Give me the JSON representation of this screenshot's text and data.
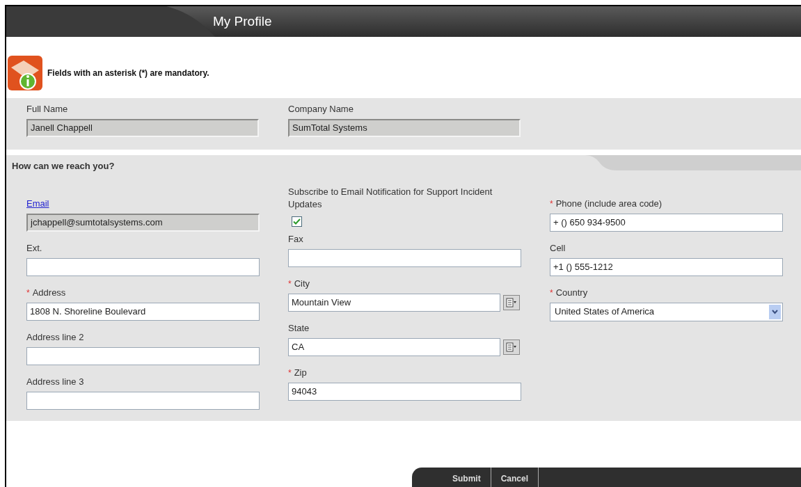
{
  "header": {
    "title": "My Profile"
  },
  "notice": "Fields with an asterisk (*) are mandatory.",
  "required_mark": "*",
  "identity": [
    {
      "label": "Full Name",
      "value": "Janell Chappell",
      "disabled": true
    },
    {
      "label": "Company Name",
      "value": "SumTotal Systems",
      "disabled": true
    }
  ],
  "contact": {
    "title": "How can we reach you?",
    "columns": [
      [
        {
          "kind": "text",
          "label": "Email",
          "link": true,
          "required": false,
          "value": "jchappell@sumtotalsystems.com",
          "disabled": true
        },
        {
          "kind": "text",
          "label": "Ext.",
          "link": false,
          "required": false,
          "disabled": false
        },
        {
          "kind": "text",
          "label": "Address",
          "link": false,
          "required": true,
          "value": "1808 N. Shoreline Boulevard",
          "disabled": false
        },
        {
          "kind": "text",
          "label": "Address line 2",
          "link": false,
          "required": false,
          "disabled": false
        },
        {
          "kind": "text",
          "label": "Address line 3",
          "link": false,
          "required": false,
          "disabled": false
        }
      ],
      [
        {
          "kind": "checkbox",
          "label": "Subscribe to Email Notification for Support Incident Updates",
          "checked": true
        },
        {
          "kind": "text",
          "label": "Fax",
          "link": false,
          "required": false,
          "disabled": false
        },
        {
          "kind": "lookup",
          "label": "City",
          "link": false,
          "required": true,
          "value": "Mountain View",
          "disabled": false
        },
        {
          "kind": "lookup",
          "label": "State",
          "link": false,
          "required": false,
          "value": "CA",
          "disabled": false
        },
        {
          "kind": "text",
          "label": "Zip",
          "link": false,
          "required": true,
          "value": "94043",
          "disabled": false
        }
      ],
      [
        {
          "kind": "text",
          "label": "Phone (include area code)",
          "link": false,
          "required": true,
          "value": "+ () 650 934-9500",
          "disabled": false
        },
        {
          "kind": "text",
          "label": "Cell",
          "link": false,
          "required": false,
          "value": "+1 () 555-1212",
          "disabled": false
        },
        {
          "kind": "select",
          "label": "Country",
          "link": false,
          "required": true,
          "value": "United States of America",
          "disabled": false
        }
      ]
    ]
  },
  "buttons": [
    "Submit",
    "Cancel"
  ]
}
